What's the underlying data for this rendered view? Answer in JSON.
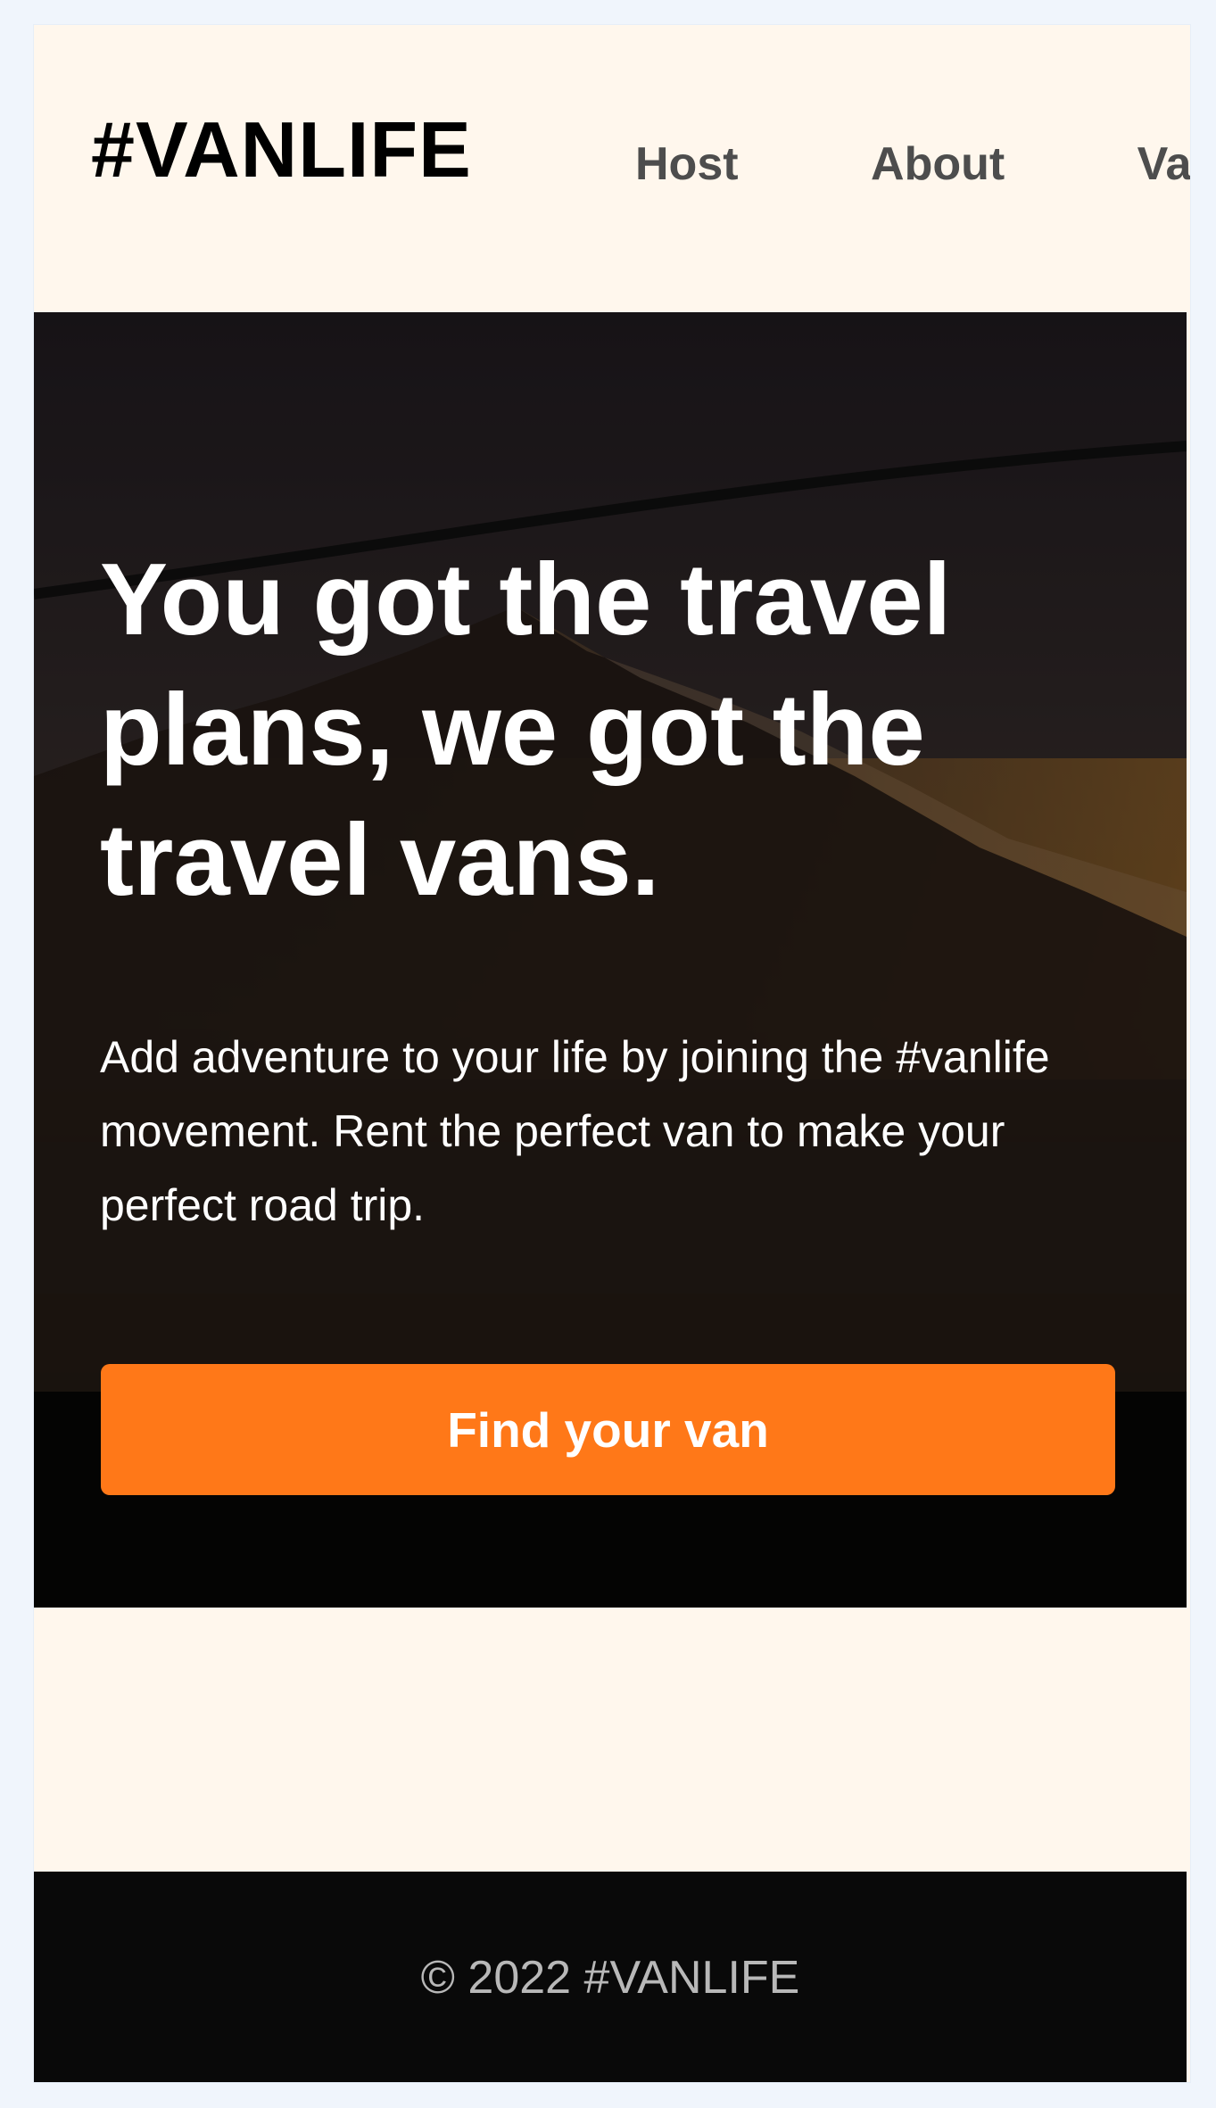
{
  "header": {
    "logo": "#VANLIFE",
    "nav": [
      {
        "label": "Host"
      },
      {
        "label": "About"
      },
      {
        "label": "Va"
      }
    ]
  },
  "hero": {
    "title": "You got the travel plans, we got the travel vans.",
    "subtitle": "Add adventure to your life by joining the #vanlife movement. Rent the perfect van to make your perfect road trip.",
    "button": "Find your van"
  },
  "footer": {
    "text": "© 2022 #VANLIFE"
  },
  "colors": {
    "page_bg": "#f0f5fc",
    "surface": "#fff7ed",
    "button": "#ff7818",
    "footer": "#090909"
  }
}
